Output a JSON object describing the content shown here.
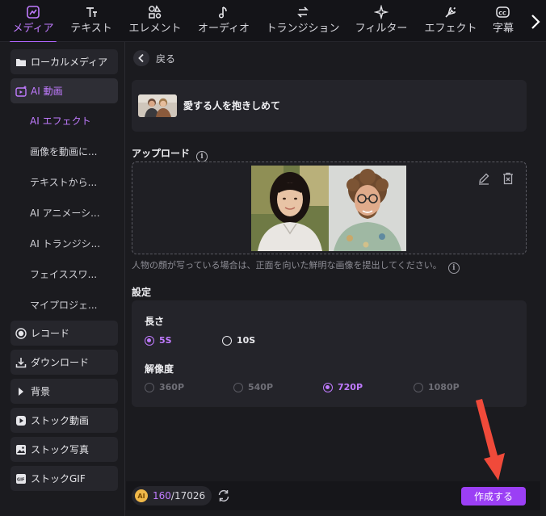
{
  "colors": {
    "accent": "#b166ff",
    "accent_text": "#c07bff",
    "button": "#9b3ff5",
    "annotation_arrow": "#f04a3a"
  },
  "toolbar": {
    "tabs": [
      {
        "label": "メディア",
        "icon": "media-icon",
        "active": true
      },
      {
        "label": "テキスト",
        "icon": "text-icon"
      },
      {
        "label": "エレメント",
        "icon": "elements-icon"
      },
      {
        "label": "オーディオ",
        "icon": "music-note-icon"
      },
      {
        "label": "トランジション",
        "icon": "transition-arrows-icon"
      },
      {
        "label": "フィルター",
        "icon": "sparkle-icon"
      },
      {
        "label": "エフェクト",
        "icon": "effect-wand-icon"
      },
      {
        "label": "字幕",
        "icon": "caption-cc-icon"
      }
    ],
    "more_icon": "chevron-right-icon"
  },
  "sidebar": {
    "items": [
      {
        "label": "ローカルメディア",
        "icon": "folder-icon"
      },
      {
        "label": "AI 動画",
        "icon": "ai-video-icon",
        "active": true
      },
      {
        "label": "レコード",
        "icon": "record-icon"
      },
      {
        "label": "ダウンロード",
        "icon": "download-icon"
      },
      {
        "label": "背景",
        "icon": "triangle-right-icon"
      },
      {
        "label": "ストック動画",
        "icon": "play-icon"
      },
      {
        "label": "ストック写真",
        "icon": "photo-icon"
      },
      {
        "label": "ストックGIF",
        "icon": "gif-icon"
      }
    ],
    "subitems": [
      {
        "label": "AI エフェクト",
        "active": true
      },
      {
        "label": "画像を動画に..."
      },
      {
        "label": "テキストから..."
      },
      {
        "label": "AI アニメーシ..."
      },
      {
        "label": "AI トランジシ..."
      },
      {
        "label": "フェイススワ..."
      },
      {
        "label": "マイプロジェ..."
      }
    ]
  },
  "main": {
    "back_label": "戻る",
    "effect": {
      "title": "愛する人を抱きしめて"
    },
    "upload": {
      "title": "アップロード",
      "hint": "人物の顔が写っている場合は、正面を向いた鮮明な画像を提出してください。"
    },
    "settings": {
      "title": "設定",
      "duration": {
        "label": "長さ",
        "options": [
          "5S",
          "10S"
        ],
        "selected": "5S"
      },
      "resolution": {
        "label": "解像度",
        "options": [
          "360P",
          "540P",
          "720P",
          "1080P"
        ],
        "selected": "720P"
      }
    }
  },
  "footer": {
    "credits_used": "160",
    "credits_total": "/17026",
    "coin_label": "AI",
    "create_label": "作成する"
  }
}
